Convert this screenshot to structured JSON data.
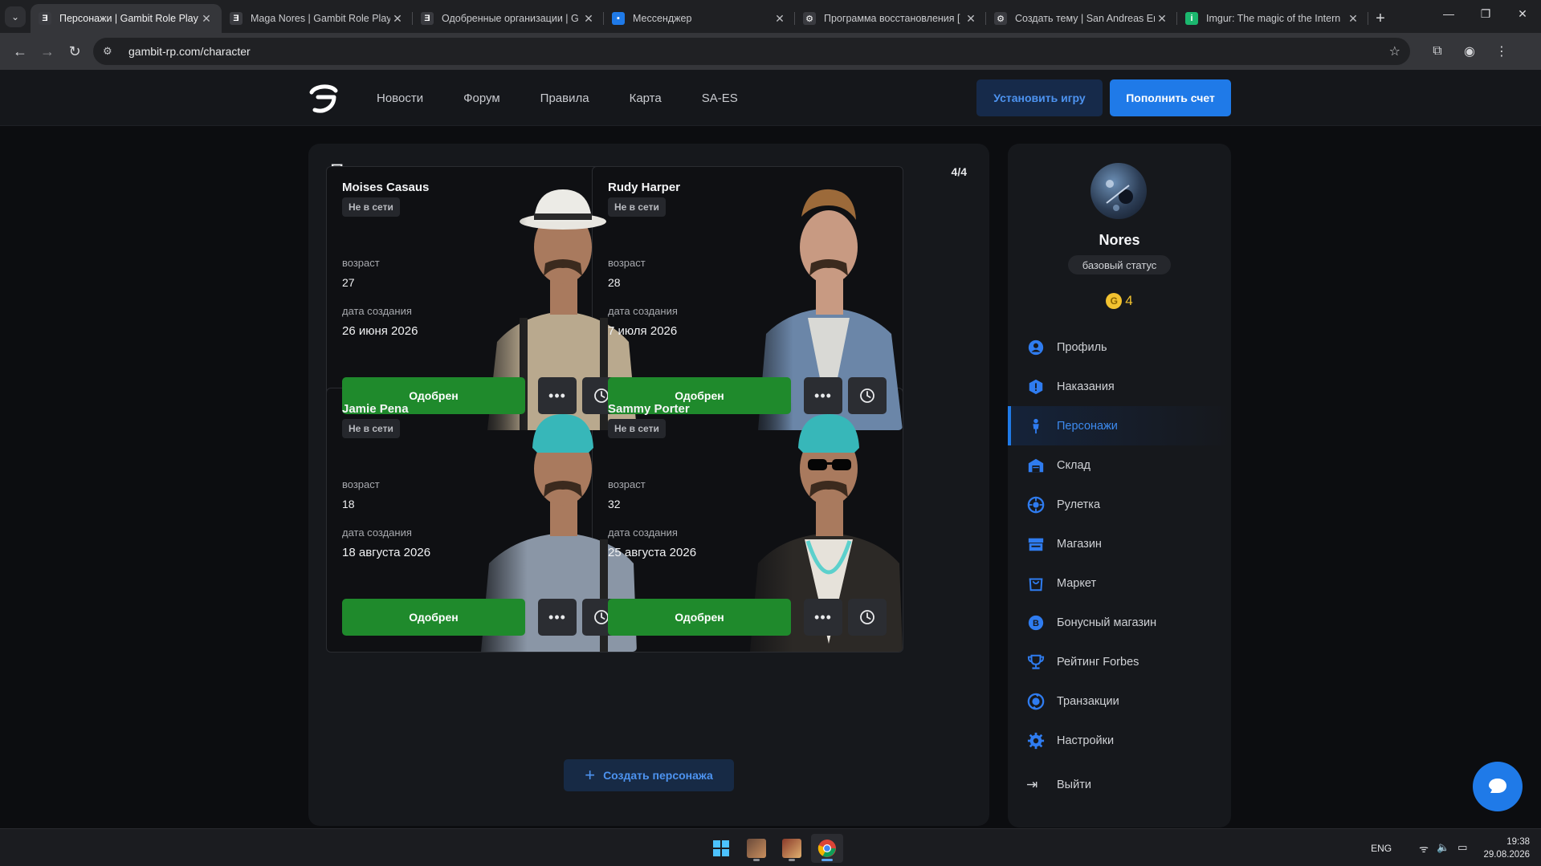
{
  "browser": {
    "tabs": [
      {
        "title": "Персонажи | Gambit Role Play",
        "favicon": "gambit-icon",
        "active": true
      },
      {
        "title": "Maga Nores | Gambit Role Play",
        "favicon": "gambit-icon",
        "active": false
      },
      {
        "title": "Одобренные организации | G",
        "favicon": "gambit-icon",
        "active": false
      },
      {
        "title": "Мессенджер",
        "favicon": "chat-icon",
        "active": false
      },
      {
        "title": "Программа восстановления [",
        "favicon": "forum-icon",
        "active": false
      },
      {
        "title": "Создать тему | San Andreas Em",
        "favicon": "forum-icon",
        "active": false
      },
      {
        "title": "Imgur: The magic of the Intern",
        "favicon": "imgur-icon",
        "active": false
      }
    ],
    "url": "gambit-rp.com/character"
  },
  "header": {
    "nav": [
      "Новости",
      "Форум",
      "Правила",
      "Карта",
      "SA-ES"
    ],
    "install_label": "Установить игру",
    "topup_label": "Пополнить счет"
  },
  "main": {
    "title": "Персонажи",
    "count": "4/4",
    "labels": {
      "age": "возраст",
      "created": "дата создания"
    },
    "characters": [
      {
        "name": "Moises Casaus",
        "status": "Не в сети",
        "age": "27",
        "created": "26 июня 2026",
        "approved_label": "Одобрен",
        "look": "hat"
      },
      {
        "name": "Rudy Harper",
        "status": "Не в сети",
        "age": "28",
        "created": "7 июля 2026",
        "approved_label": "Одобрен",
        "look": "plain"
      },
      {
        "name": "Jamie Pena",
        "status": "Не в сети",
        "age": "18",
        "created": "18 августа 2026",
        "approved_label": "Одобрен",
        "look": "bandana"
      },
      {
        "name": "Sammy Porter",
        "status": "Не в сети",
        "age": "32",
        "created": "25 августа 2026",
        "approved_label": "Одобрен",
        "look": "bandana-glasses"
      }
    ],
    "create_label": "Создать персонажа"
  },
  "sidebar": {
    "username": "Nores",
    "status": "базовый статус",
    "coins": "4",
    "menu": [
      {
        "label": "Профиль",
        "icon": "user-icon",
        "active": false
      },
      {
        "label": "Наказания",
        "icon": "warning-icon",
        "active": false
      },
      {
        "label": "Персонажи",
        "icon": "person-icon",
        "active": true
      },
      {
        "label": "Склад",
        "icon": "warehouse-icon",
        "active": false
      },
      {
        "label": "Рулетка",
        "icon": "roulette-icon",
        "active": false
      },
      {
        "label": "Магазин",
        "icon": "store-icon",
        "active": false
      },
      {
        "label": "Маркет",
        "icon": "market-icon",
        "active": false
      },
      {
        "label": "Бонусный магазин",
        "icon": "bonus-icon",
        "active": false
      },
      {
        "label": "Рейтинг Forbes",
        "icon": "trophy-icon",
        "active": false
      },
      {
        "label": "Транзакции",
        "icon": "transactions-icon",
        "active": false
      },
      {
        "label": "Настройки",
        "icon": "settings-icon",
        "active": false
      }
    ],
    "logout_label": "Выйти"
  },
  "taskbar": {
    "lang": "ENG",
    "time": "19:38",
    "date": "29.08.2026"
  },
  "colors": {
    "accent": "#1f7ae8",
    "approved": "#1f8a2c",
    "coin": "#f2c230"
  }
}
